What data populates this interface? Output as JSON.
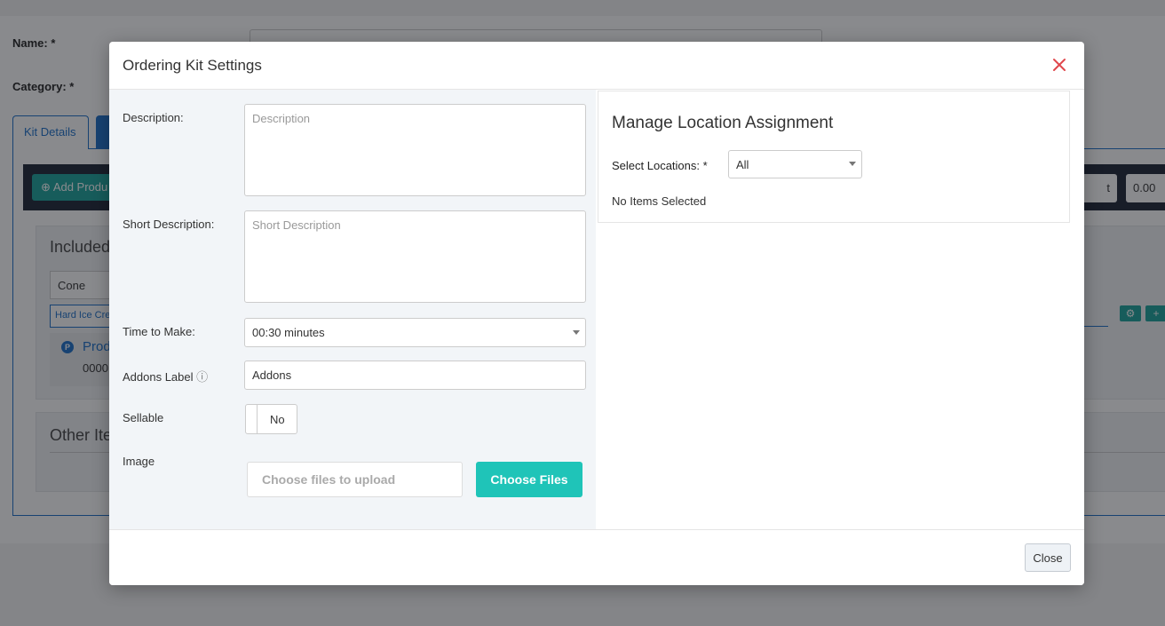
{
  "background": {
    "name_label": "Name: *",
    "category_label": "Category: *",
    "tab_kit_details": "Kit Details",
    "add_product_label": "Add Produ",
    "select_value": "t",
    "price_value": "0.00",
    "included_title": "Included",
    "cone_value": "Cone",
    "chip_text": "Hard Ice Cre",
    "product_badge": "P",
    "product_name": "Prod",
    "product_code": "0000",
    "other_title": "Other Ite"
  },
  "modal": {
    "title": "Ordering Kit Settings",
    "close_icon": "close-x-icon",
    "fields": {
      "description_label": "Description:",
      "description_placeholder": "Description",
      "short_description_label": "Short Description:",
      "short_description_placeholder": "Short Description",
      "time_to_make_label": "Time to Make:",
      "time_to_make_value": "00:30 minutes",
      "addons_label_label": "Addons Label",
      "addons_info_icon": "ⓘ",
      "addons_label_value": "Addons",
      "sellable_label": "Sellable",
      "sellable_value": "No",
      "image_label": "Image",
      "upload_placeholder": "Choose files to upload",
      "upload_button": "Choose Files"
    },
    "locations": {
      "title": "Manage Location Assignment",
      "select_label": "Select Locations: *",
      "select_value": "All",
      "empty_text": "No Items Selected"
    },
    "footer": {
      "close_label": "Close"
    }
  },
  "colors": {
    "accent_teal": "#1fc4b8",
    "close_red": "#e0474c",
    "link_blue": "#1a6fc9"
  }
}
